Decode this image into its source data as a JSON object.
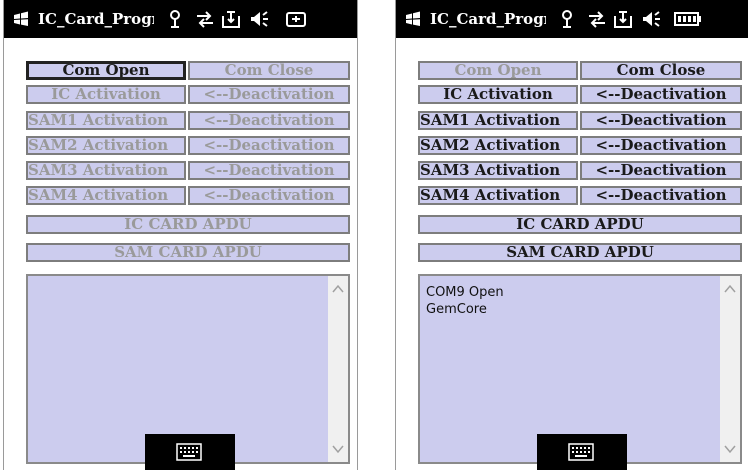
{
  "app_title": "IC_Card_Progr",
  "icons": {
    "start": "windows-flag-icon",
    "signal": "antenna-icon",
    "sync": "sync-arrows-icon",
    "hold": "inbox-icon",
    "volume": "speaker-icon",
    "left_power": "charging-plug-icon",
    "right_power": "battery-icon",
    "keyboard": "keyboard-icon"
  },
  "labels": {
    "com_open": "Com Open",
    "com_close": "Com Close",
    "ic_activation": "IC  Activation",
    "deactivation": "<--Deactivation",
    "sam1_activation": "SAM1  Activation",
    "sam2_activation": "SAM2  Activation",
    "sam3_activation": "SAM3  Activation",
    "sam4_activation": "SAM4  Activation",
    "ic_card_apdu": "IC CARD APDU",
    "sam_card_apdu": "SAM CARD APDU"
  },
  "left_screen": {
    "log_text": ""
  },
  "right_screen": {
    "log_text": "COM9 Open\nGemCore"
  },
  "colors": {
    "button_bg": "#ccccee",
    "disabled_text": "#9a9a9a",
    "enabled_text": "#1a1a1a",
    "titlebar_bg": "#000000"
  }
}
